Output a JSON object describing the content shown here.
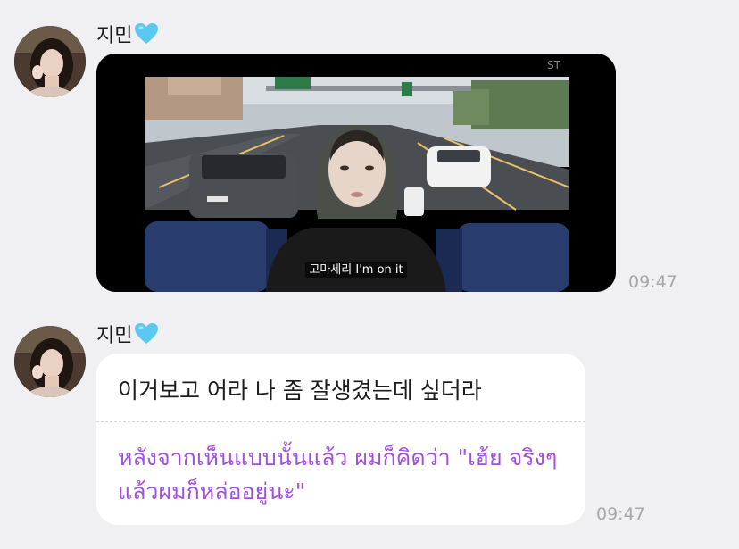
{
  "chat": {
    "sender_name": "지민",
    "heart_icon": "light-blue-heart-icon",
    "heart_color": "#5bc8f0",
    "accent_color": "#a24fe0",
    "messages": [
      {
        "type": "video",
        "subtitle": "고마세리 I'm on it",
        "watermark": "ST",
        "time": "09:47"
      },
      {
        "type": "text",
        "text": "이거보고 어라 나 좀 잘생겼는데 싶더라",
        "translation": "หลังจากเห็นแบบนั้นแล้ว ผมก็คิดว่า \"เฮ้ย จริงๆ แล้วผมก็หล่ออยู่นะ\"",
        "time": "09:47"
      }
    ]
  }
}
